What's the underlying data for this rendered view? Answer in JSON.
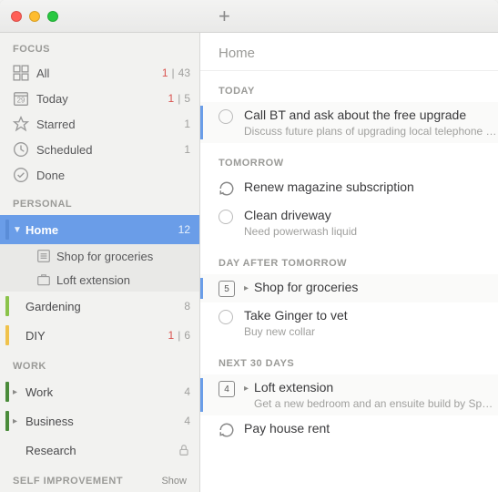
{
  "header": {
    "title": "Home"
  },
  "sidebar": {
    "sections": {
      "focus": {
        "label": "FOCUS",
        "items": [
          {
            "label": "All",
            "red": "1",
            "count": "43"
          },
          {
            "label": "Today",
            "red": "1",
            "count": "5"
          },
          {
            "label": "Starred",
            "count": "1"
          },
          {
            "label": "Scheduled",
            "count": "1"
          },
          {
            "label": "Done"
          }
        ]
      },
      "personal": {
        "label": "PERSONAL",
        "items": [
          {
            "label": "Home",
            "count": "12",
            "children": [
              {
                "label": "Shop for groceries"
              },
              {
                "label": "Loft extension"
              }
            ]
          },
          {
            "label": "Gardening",
            "count": "8"
          },
          {
            "label": "DIY",
            "red": "1",
            "count": "6"
          }
        ]
      },
      "work": {
        "label": "WORK",
        "items": [
          {
            "label": "Work",
            "count": "4"
          },
          {
            "label": "Business",
            "count": "4"
          },
          {
            "label": "Research"
          }
        ]
      },
      "self": {
        "label": "SELF IMPROVEMENT",
        "show": "Show"
      }
    }
  },
  "main": {
    "groups": [
      {
        "label": "TODAY",
        "tasks": [
          {
            "title": "Call BT and ask about the free upgrade",
            "note": "Discuss future plans of upgrading local telephone exc",
            "circle": true,
            "selected": true
          }
        ]
      },
      {
        "label": "TOMORROW",
        "tasks": [
          {
            "title": "Renew magazine subscription",
            "repeat": true
          },
          {
            "title": "Clean driveway",
            "note": "Need powerwash liquid",
            "circle": true
          }
        ]
      },
      {
        "label": "DAY AFTER TOMORROW",
        "tasks": [
          {
            "title": "Shop for groceries",
            "badge": "5",
            "disclosure": true,
            "selected": true
          },
          {
            "title": "Take Ginger to vet",
            "note": "Buy new collar",
            "circle": true
          }
        ]
      },
      {
        "label": "NEXT 30 DAYS",
        "tasks": [
          {
            "title": "Loft extension",
            "note": "Get a new bedroom and an ensuite build by Spec B",
            "badge": "4",
            "disclosure": true,
            "selected": true
          },
          {
            "title": "Pay house rent",
            "repeat": true
          }
        ]
      }
    ]
  }
}
